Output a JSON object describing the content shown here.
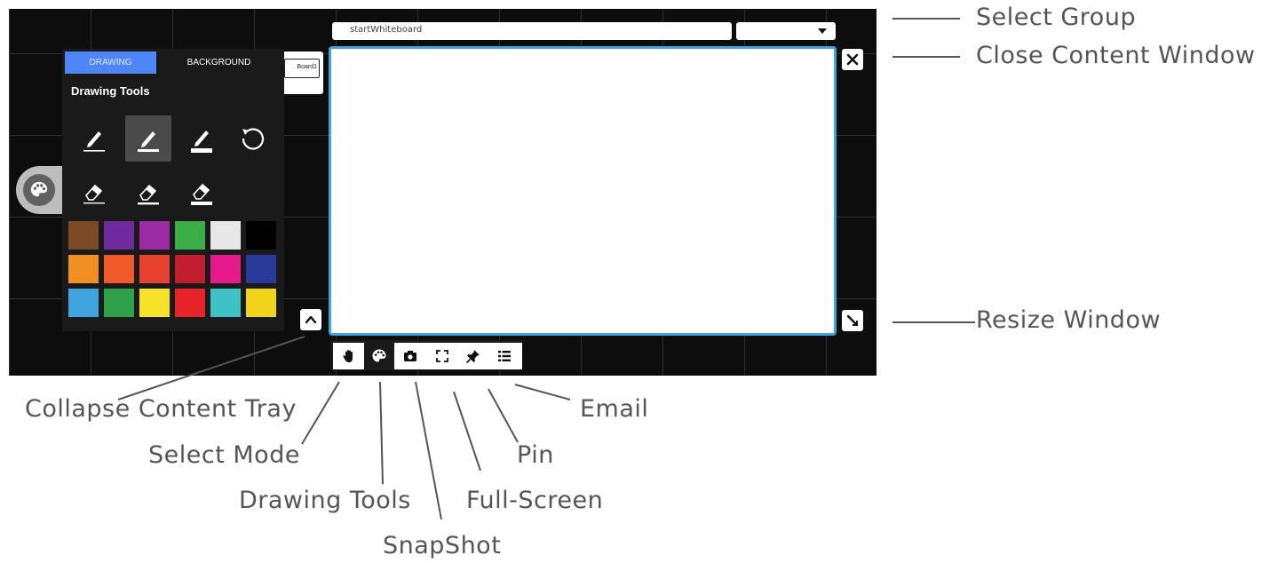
{
  "header": {
    "group_field_value": "startWhiteboard",
    "group_select_value": ""
  },
  "thumbnail": {
    "label": "Board1"
  },
  "drawing_panel": {
    "tabs": [
      {
        "label": "DRAWING",
        "active": true
      },
      {
        "label": "BACKGROUND",
        "active": false
      }
    ],
    "title": "Drawing Tools",
    "tools": [
      {
        "icon": "pen-fine-icon"
      },
      {
        "icon": "pen-medium-icon",
        "selected": true
      },
      {
        "icon": "pen-thick-icon"
      },
      {
        "icon": "undo-icon"
      },
      {
        "icon": "eraser-small-icon"
      },
      {
        "icon": "eraser-medium-icon"
      },
      {
        "icon": "eraser-large-icon"
      }
    ],
    "colors": [
      "#7b4a24",
      "#6e2a9e",
      "#9b2ca3",
      "#3cae47",
      "#e8e8e8",
      "#000000",
      "#f18f22",
      "#ef5a28",
      "#e8412f",
      "#c21e2f",
      "#e6198b",
      "#2a3a9b",
      "#3fa4e0",
      "#2ea04a",
      "#f6e226",
      "#e8242a",
      "#3ec3c4",
      "#f2d31b"
    ]
  },
  "toolbar": {
    "buttons": [
      {
        "icon": "hand-icon",
        "name": "select-mode"
      },
      {
        "icon": "palette-icon",
        "name": "drawing-tools"
      },
      {
        "icon": "camera-icon",
        "name": "snapshot"
      },
      {
        "icon": "fullscreen-icon",
        "name": "full-screen"
      },
      {
        "icon": "pin-icon",
        "name": "pin"
      },
      {
        "icon": "list-icon",
        "name": "email"
      }
    ]
  },
  "callouts": {
    "select_group": "Select Group",
    "close_content_window": "Close Content Window",
    "resize_window": "Resize Window",
    "collapse_content_tray": "Collapse Content Tray",
    "select_mode": "Select Mode",
    "drawing_tools": "Drawing Tools",
    "snapshot": "SnapShot",
    "full_screen": "Full-Screen",
    "pin": "Pin",
    "email": "Email"
  },
  "colors": {
    "accent_tab": "#4f86f7",
    "window_border": "#3fa4e0",
    "stage_background": "#0d0d0d",
    "callout_text": "#555555"
  }
}
